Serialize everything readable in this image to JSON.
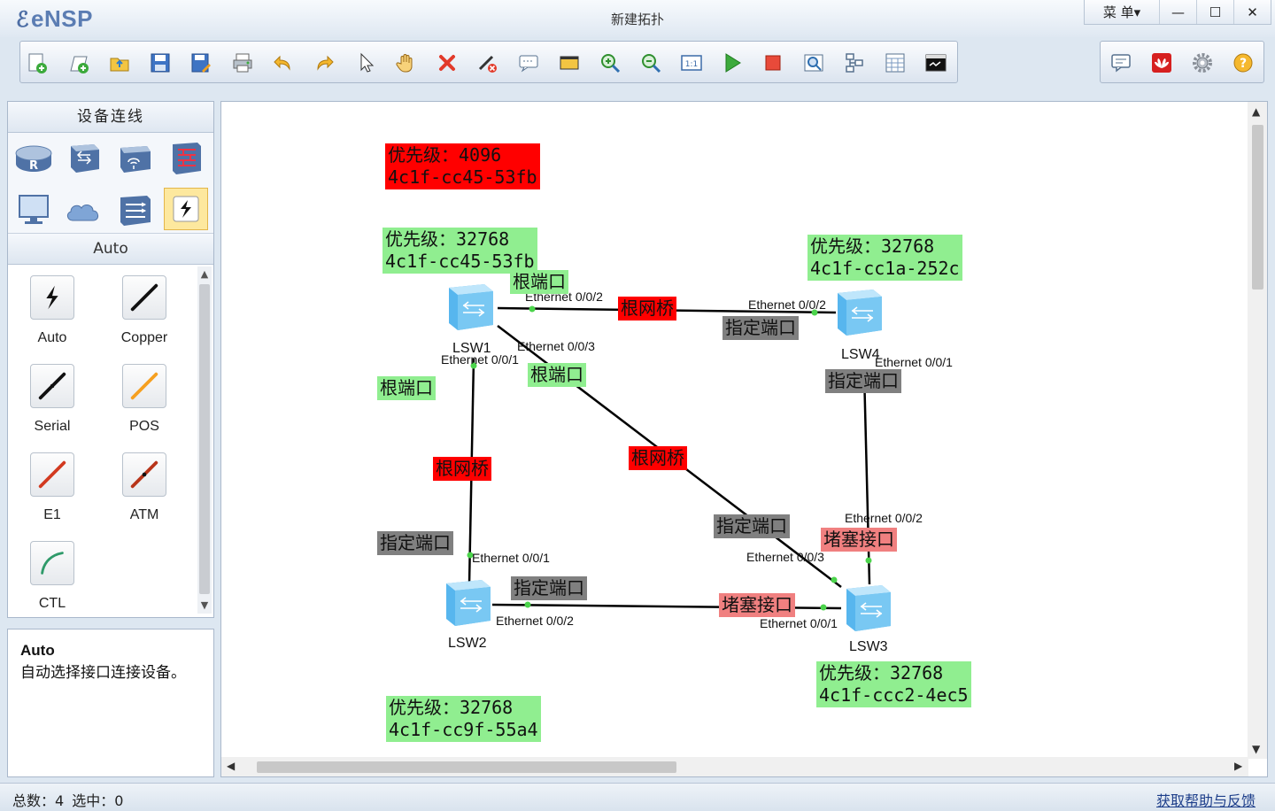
{
  "app": {
    "name": "eNSP",
    "window_title": "新建拓扑"
  },
  "window_controls": {
    "menu": "菜 单▾",
    "minimize": "—",
    "maximize": "☐",
    "close": "✕"
  },
  "toolbar": {
    "icons": [
      "new-topology-icon",
      "new-blank-icon",
      "open-icon",
      "save-icon",
      "save-as-icon",
      "print-icon",
      "undo-icon",
      "redo-icon",
      "select-icon",
      "pan-hand-icon",
      "delete-icon",
      "delete-links-icon",
      "add-text-icon",
      "add-shape-icon",
      "zoom-in-icon",
      "zoom-out-icon",
      "fit-view-icon",
      "start-device-icon",
      "stop-device-icon",
      "capture-icon",
      "topology-icon",
      "grid-icon",
      "console-icon"
    ],
    "right_icons": [
      "message-icon",
      "huawei-icon",
      "settings-icon",
      "help-icon"
    ]
  },
  "palette": {
    "header": "设备连线",
    "devices": [
      "router-icon",
      "switch-icon",
      "wlan-icon",
      "firewall-icon",
      "pc-icon",
      "cloud-icon",
      "other-device-icon",
      "connection-icon"
    ],
    "section": "Auto",
    "cables": [
      {
        "label": "Auto",
        "icon": "auto-cable-icon"
      },
      {
        "label": "Copper",
        "icon": "copper-cable-icon"
      },
      {
        "label": "Serial",
        "icon": "serial-cable-icon"
      },
      {
        "label": "POS",
        "icon": "pos-cable-icon"
      },
      {
        "label": "E1",
        "icon": "e1-cable-icon"
      },
      {
        "label": "ATM",
        "icon": "atm-cable-icon"
      },
      {
        "label": "CTL",
        "icon": "ctl-cable-icon"
      }
    ]
  },
  "description": {
    "title": "Auto",
    "text": "自动选择接口连接设备。"
  },
  "topology": {
    "devices": {
      "lsw1": "LSW1",
      "lsw2": "LSW2",
      "lsw3": "LSW3",
      "lsw4": "LSW4"
    },
    "labels": {
      "root_prio": "优先级：4096\n4c1f-cc45-53fb",
      "lsw1_prio": "优先级：32768\n4c1f-cc45-53fb",
      "lsw4_prio": "优先级：32768\n4c1f-cc1a-252c",
      "lsw3_prio": "优先级：32768\n4c1f-ccc2-4ec5",
      "lsw2_prio": "优先级：32768\n4c1f-cc9f-55a4",
      "root_port_a": "根端口",
      "root_port_b": "根端口",
      "root_port_c": "根端口",
      "root_bridge_a": "根网桥",
      "root_bridge_b": "根网桥",
      "root_bridge_c": "根网桥",
      "designated_a": "指定端口",
      "designated_b": "指定端口",
      "designated_c": "指定端口",
      "designated_d": "指定端口",
      "designated_e": "指定端口",
      "blocked_a": "堵塞接口",
      "blocked_b": "堵塞接口"
    },
    "ports": {
      "lsw1_002": "Ethernet 0/0/2",
      "lsw1_003": "Ethernet 0/0/3",
      "lsw1_001": "Ethernet 0/0/1",
      "lsw4_002": "Ethernet 0/0/2",
      "lsw4_001": "Ethernet 0/0/1",
      "lsw2_001": "Ethernet 0/0/1",
      "lsw2_002": "Ethernet 0/0/2",
      "lsw3_002": "Ethernet 0/0/2",
      "lsw3_003": "Ethernet 0/0/3",
      "lsw3_001": "Ethernet 0/0/1"
    }
  },
  "status": {
    "total": "总数：4 选中：0",
    "help": "获取帮助与反馈"
  }
}
